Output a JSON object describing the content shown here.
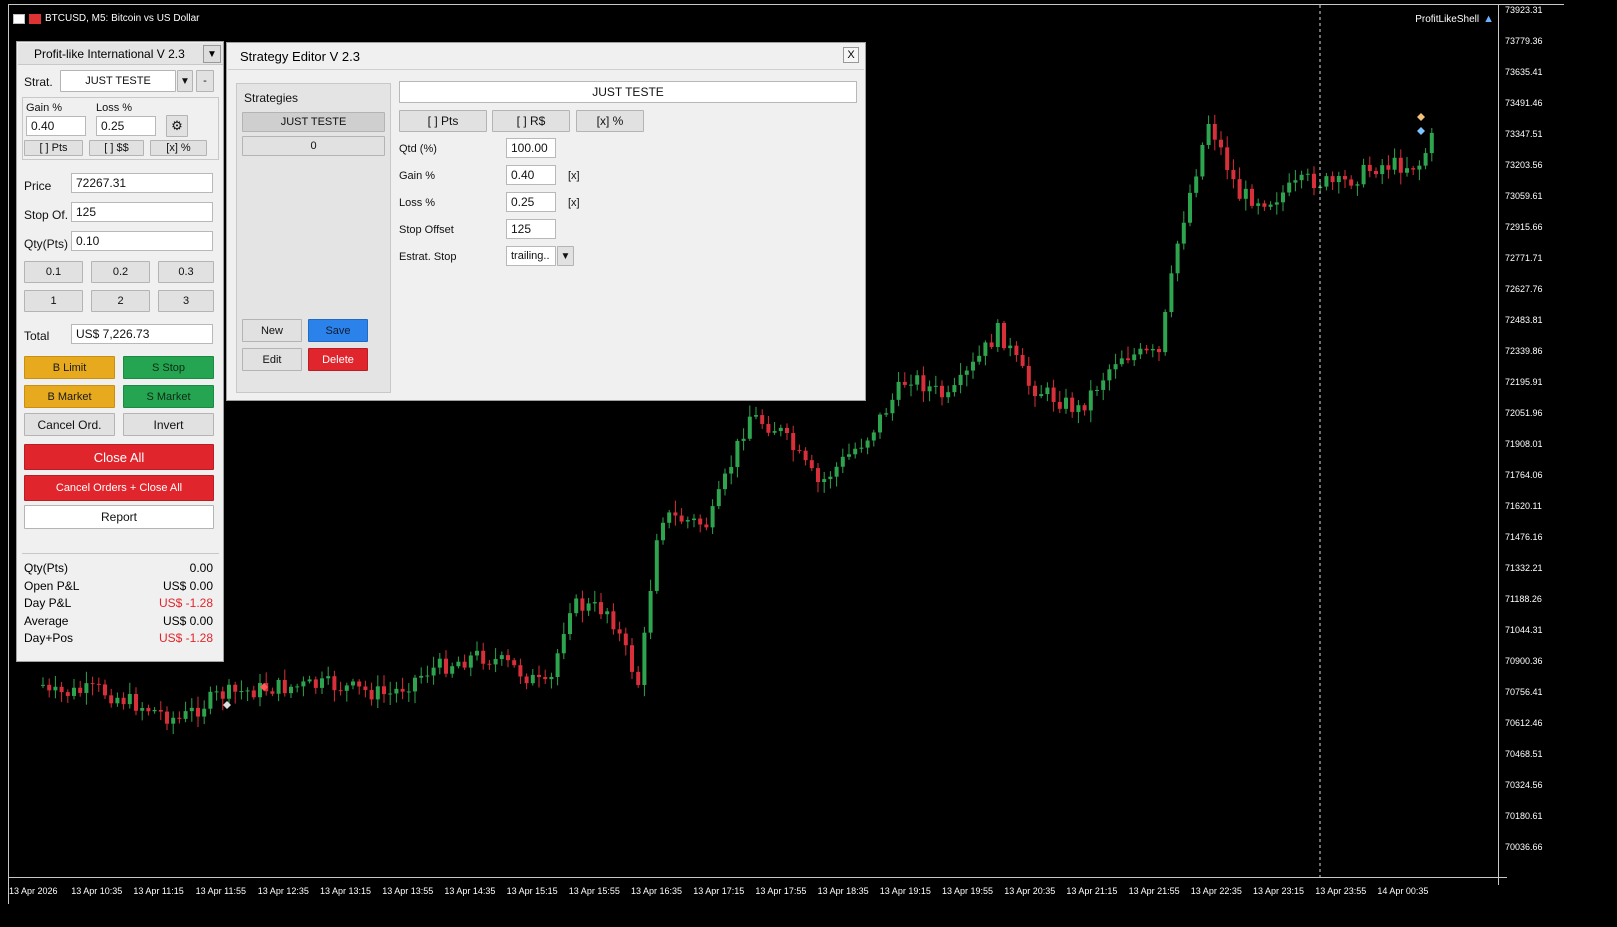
{
  "chart": {
    "title": "BTCUSD, M5:  Bitcoin vs US Dollar",
    "expert_name": "ProfitLikeShell",
    "price_ticks": [
      "73923.31",
      "73779.36",
      "73635.41",
      "73491.46",
      "73347.51",
      "73203.56",
      "73059.61",
      "72915.66",
      "72771.71",
      "72627.76",
      "72483.81",
      "72339.86",
      "72195.91",
      "72051.96",
      "71908.01",
      "71764.06",
      "71620.11",
      "71476.16",
      "71332.21",
      "71188.26",
      "71044.31",
      "70900.36",
      "70756.41",
      "70612.46",
      "70468.51",
      "70324.56",
      "70180.61",
      "70036.66"
    ],
    "time_ticks": [
      "13 Apr 2026",
      "13 Apr 10:35",
      "13 Apr 11:15",
      "13 Apr 11:55",
      "13 Apr 12:35",
      "13 Apr 13:15",
      "13 Apr 13:55",
      "13 Apr 14:35",
      "13 Apr 15:15",
      "13 Apr 15:55",
      "13 Apr 16:35",
      "13 Apr 17:15",
      "13 Apr 17:55",
      "13 Apr 18:35",
      "13 Apr 19:15",
      "13 Apr 19:55",
      "13 Apr 20:35",
      "13 Apr 21:15",
      "13 Apr 21:55",
      "13 Apr 22:35",
      "13 Apr 23:15",
      "13 Apr 23:55",
      "14 Apr 00:35"
    ],
    "up_color": "#2ea44f",
    "down_color": "#d7303a"
  },
  "trade_panel": {
    "title": "Profit-like International V 2.3",
    "strat_label": "Strat.",
    "strat_value": "JUST TESTE",
    "minus_label": "-",
    "gain_label": "Gain %",
    "loss_label": "Loss %",
    "gain_value": "0.40",
    "loss_value": "0.25",
    "mode_pts": "[ ] Pts",
    "mode_money": "[ ] $$",
    "mode_pct": "[x] %",
    "price_label": "Price",
    "price_value": "72267.31",
    "stop_label": "Stop Of.",
    "stop_value": "125",
    "qty_label": "Qty(Pts)",
    "qty_value": "0.10",
    "qty_buttons": [
      "0.1",
      "0.2",
      "0.3",
      "1",
      "2",
      "3"
    ],
    "total_label": "Total",
    "total_value": "US$ 7,226.73",
    "b_limit": "B Limit",
    "s_stop": "S Stop",
    "b_market": "B Market",
    "s_market": "S Market",
    "cancel_ord": "Cancel Ord.",
    "invert": "Invert",
    "close_all": "Close All",
    "cancel_close_all": "Cancel Orders + Close All",
    "report": "Report",
    "stats": [
      {
        "label": "Qty(Pts)",
        "value": "0.00",
        "negative": false
      },
      {
        "label": "Open P&L",
        "value": "US$ 0.00",
        "negative": false
      },
      {
        "label": "Day P&L",
        "value": "US$ -1.28",
        "negative": true
      },
      {
        "label": "Average",
        "value": "US$ 0.00",
        "negative": false
      },
      {
        "label": "Day+Pos",
        "value": "US$ -1.28",
        "negative": true
      }
    ]
  },
  "strategy_editor": {
    "title": "Strategy Editor V 2.3",
    "close_label": "X",
    "strategies_label": "Strategies",
    "strategies": [
      "JUST TESTE",
      "0"
    ],
    "name_value": "JUST TESTE",
    "mode_pts": "[ ] Pts",
    "mode_rs": "[ ] R$",
    "mode_pct": "[x] %",
    "qtd_label": "Qtd (%)",
    "qtd_value": "100.00",
    "gain_label": "Gain %",
    "gain_value": "0.40",
    "gain_check": "[x]",
    "loss_label": "Loss %",
    "loss_value": "0.25",
    "loss_check": "[x]",
    "offset_label": "Stop Offset",
    "offset_value": "125",
    "estrat_label": "Estrat. Stop",
    "estrat_value": "trailing..",
    "new_label": "New",
    "save_label": "Save",
    "edit_label": "Edit",
    "delete_label": "Delete"
  }
}
